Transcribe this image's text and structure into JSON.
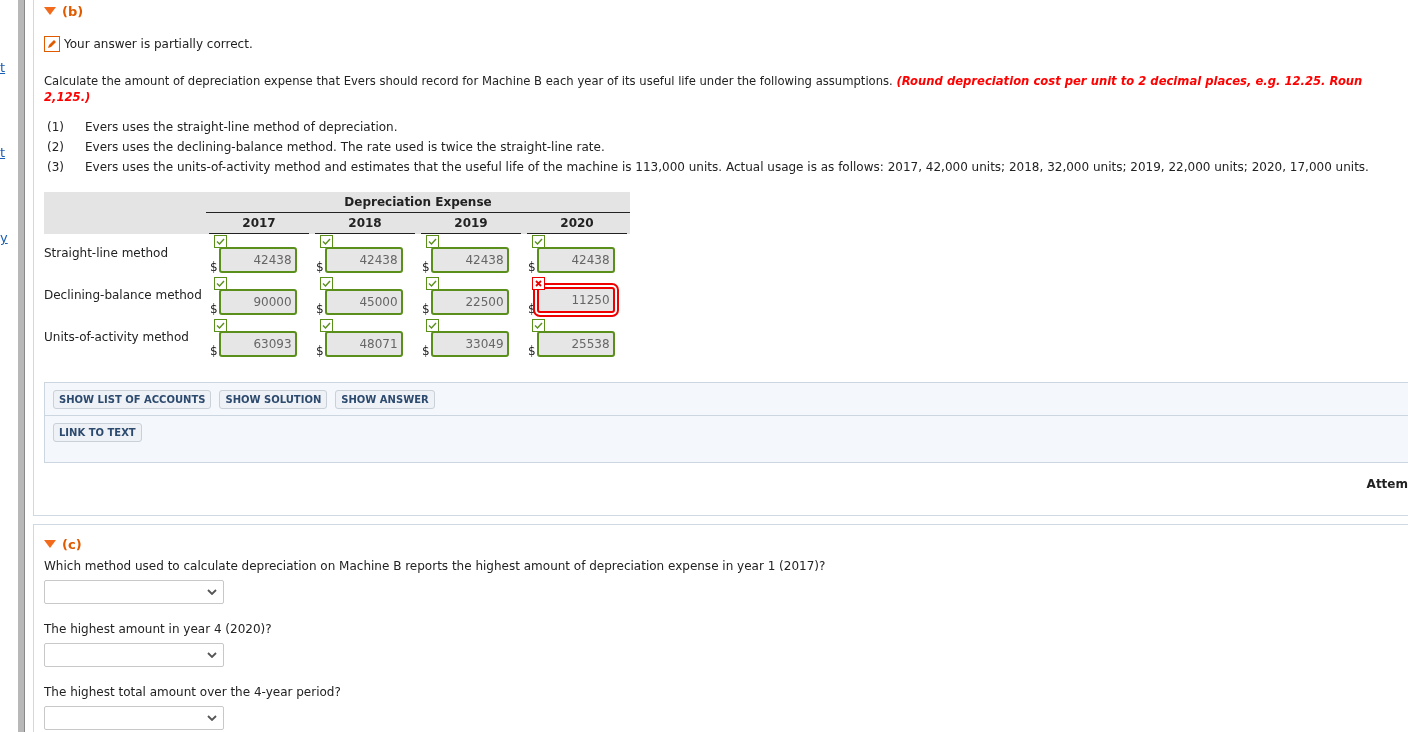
{
  "sidebar": {
    "links": [
      "t",
      "t",
      "y"
    ]
  },
  "part_b": {
    "label": "(b)",
    "expanded": true,
    "result": {
      "text": "Your answer is partially correct."
    },
    "instructions": {
      "text": "Calculate the amount of depreciation expense that Evers should record for Machine B each year of its useful life under the following assumptions. ",
      "note_lines": [
        "(Round depreciation cost per unit to 2 decimal places, e.g. 12.25. Roun",
        "2,125.)"
      ]
    },
    "assumptions": [
      {
        "number": "(1)",
        "text": "Evers uses the straight-line method of depreciation."
      },
      {
        "number": "(2)",
        "text": "Evers uses the declining-balance method. The rate used is twice the straight-line rate."
      },
      {
        "number": "(3)",
        "text": "Evers uses the units-of-activity method and estimates that the useful life of the machine is 113,000 units. Actual usage is as follows: 2017, 42,000 units; 2018, 32,000 units; 2019, 22,000 units; 2020, 17,000 units."
      }
    ],
    "table": {
      "group_header": "Depreciation Expense",
      "columns": [
        "2017",
        "2018",
        "2019",
        "2020"
      ],
      "rows": [
        {
          "label": "Straight-line method",
          "cells": [
            {
              "currency": "$",
              "value": "42438",
              "correct": true
            },
            {
              "currency": "$",
              "value": "42438",
              "correct": true
            },
            {
              "currency": "$",
              "value": "42438",
              "correct": true
            },
            {
              "currency": "$",
              "value": "42438",
              "correct": true
            }
          ]
        },
        {
          "label": "Declining-balance method",
          "cells": [
            {
              "currency": "$",
              "value": "90000",
              "correct": true
            },
            {
              "currency": "$",
              "value": "45000",
              "correct": true
            },
            {
              "currency": "$",
              "value": "22500",
              "correct": true
            },
            {
              "currency": "$",
              "value": "11250",
              "correct": false
            }
          ]
        },
        {
          "label": "Units-of-activity method",
          "cells": [
            {
              "currency": "$",
              "value": "63093",
              "correct": true
            },
            {
              "currency": "$",
              "value": "48071",
              "correct": true
            },
            {
              "currency": "$",
              "value": "33049",
              "correct": true
            },
            {
              "currency": "$",
              "value": "25538",
              "correct": true
            }
          ]
        }
      ]
    },
    "buttons": [
      "SHOW LIST OF ACCOUNTS",
      "SHOW SOLUTION",
      "SHOW ANSWER"
    ],
    "link_buttons": [
      "LINK TO TEXT"
    ]
  },
  "attempts_label": "Attem",
  "part_c": {
    "label": "(c)",
    "expanded": true,
    "questions": [
      {
        "text": "Which method used to calculate depreciation on Machine B reports the highest amount of depreciation expense in year 1 (2017)?"
      },
      {
        "text": "The highest amount in year 4 (2020)?"
      },
      {
        "text": "The highest total amount over the 4-year period?"
      }
    ]
  }
}
